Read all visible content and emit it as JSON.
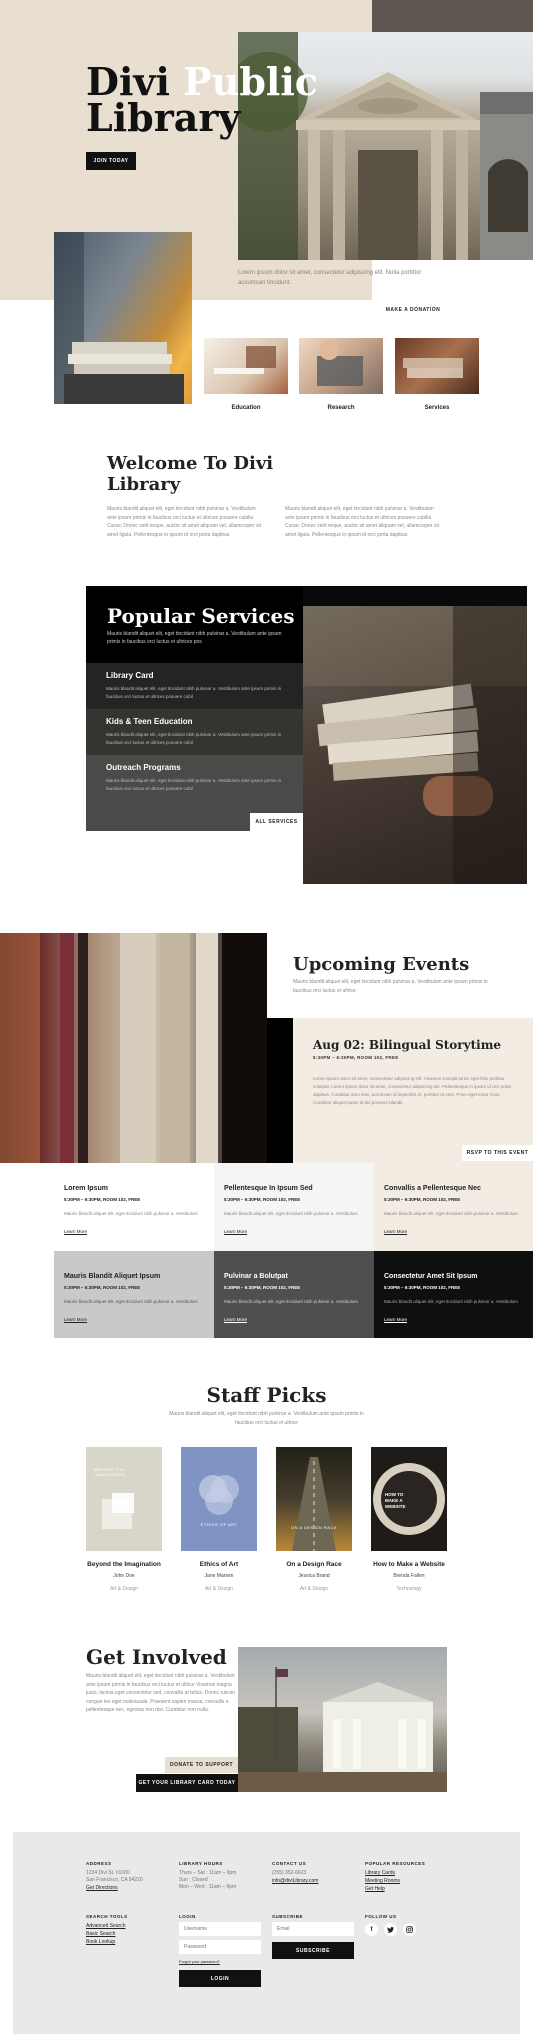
{
  "hero": {
    "title_line1_dark": "Divi",
    "title_line1_light": "Public",
    "title_line2": "Library",
    "join_button": "JOIN TODAY",
    "caption": "Lorem ipsum dolor sit amet, consectetur adipiscing elit. Nulla porttitor accumsan tincidunt.",
    "donation_button": "MAKE A DONATION",
    "tiles": [
      {
        "label": "Education"
      },
      {
        "label": "Research"
      },
      {
        "label": "Services"
      }
    ]
  },
  "welcome": {
    "title_line1": "Welcome To Divi",
    "title_line2": "Library",
    "col1": "Mauris blandit aliquet elit, eget tincidunt nibh pulvinar a. Vestibulum ante ipsum primis in faucibus orci luctus et ultrices posuere cubilia Curae; Donec velit neque, auctor sit amet aliquam vel, ullamcorper sit amet ligula. Pellentesque in ipsum id orci porta dapibus.",
    "col2": "Mauris blandit aliquet elit, eget tincidunt nibh pulvinar a. Vestibulum ante ipsum primis in faucibus orci luctus et ultrices posuere cubilia Curae; Donec velit neque, auctor sit amet aliquam vel, ullamcorper sit amet ligula. Pellentesque in ipsum id orci porta dapibus."
  },
  "services": {
    "title": "Popular Services",
    "intro": "Mauris blandit aliquet elit, eget tincidunt nibh pulvinar a. Vestibulum ante ipsum primis in faucibus orci luctus et ultrices pos",
    "items": [
      {
        "title": "Library Card",
        "text": "Mauris blandit aliquet elit, eget tincidunt nibh pulvinar a. Vestibulum ante ipsum primis in faucibus orci luctus et ultrices posuere cubil"
      },
      {
        "title": "Kids & Teen Education",
        "text": "Mauris blandit aliquet elit, eget tincidunt nibh pulvinar a. Vestibulum ante ipsum primis in faucibus orci luctus et ultrices posuere cubil"
      },
      {
        "title": "Outreach Programs",
        "text": "Mauris blandit aliquet elit, eget tincidunt nibh pulvinar a. Vestibulum ante ipsum primis in faucibus orci luctus et ultrices posuere cubil"
      }
    ],
    "all_button": "ALL SERVICES"
  },
  "events": {
    "title": "Upcoming Events",
    "intro": "Mauris blandit aliquet elit, eget tincidunt nibh pulvinar a. Vestibulum ante ipsum primis in faucibus orci luctus et ultrice",
    "featured": {
      "title": "Aug 02: Bilingual Storytime",
      "meta": "5:30PM – 6:30PM, ROOM 102, FREE",
      "text": "Lorem ipsum dolor sit amet, consectetur adipiscing elit. Vivamus suscipit tortor eget felis porttitor volutpat. Lorem ipsum dolor sit amet, consectetur adipiscing elit. Pellentesque in ipsum id orci porta dapibus. Curabitur arcu erat, accumsan id imperdiet et, porttitor at sem. Proin eget tortor risus. Curabitur aliquet quam id dui posuere blandit.",
      "button": "RSVP TO THIS EVENT"
    },
    "cards": [
      {
        "title": "Lorem Ipsum",
        "meta": "5:30PM – 6:30PM, ROOM 102, FREE",
        "text": "Mauris blandit aliquet elit, eget tincidunt nibh pulvinar a. Vestibulum",
        "link": "Learn More"
      },
      {
        "title": "Pellentesque In Ipsum Sed",
        "meta": "5:30PM – 6:30PM, ROOM 102, FREE",
        "text": "Mauris blandit aliquet elit, eget tincidunt nibh pulvinar a. Vestibulum",
        "link": "Learn More"
      },
      {
        "title": "Convallis a Pellentesque Nec",
        "meta": "5:30PM – 6:30PM, ROOM 102, FREE",
        "text": "Mauris blandit aliquet elit, eget tincidunt nibh pulvinar a. Vestibulum",
        "link": "Learn More"
      },
      {
        "title": "Mauris Blandit Aliquet Ipsum",
        "meta": "5:30PM – 6:30PM, ROOM 102, FREE",
        "text": "Mauris blandit aliquet elit, eget tincidunt nibh pulvinar a. Vestibulum",
        "link": "Learn More"
      },
      {
        "title": "Pulvinar a Bolutpat",
        "meta": "5:30PM – 6:30PM, ROOM 102, FREE",
        "text": "Mauris blandit aliquet elit, eget tincidunt nibh pulvinar a. Vestibulum",
        "link": "Learn More"
      },
      {
        "title": "Consectetur Amet Sit Ipsum",
        "meta": "5:30PM – 6:30PM, ROOM 102, FREE",
        "text": "Mauris blandit aliquet elit, eget tincidunt nibh pulvinar a. Vestibulum",
        "link": "Learn More"
      }
    ]
  },
  "staff": {
    "title": "Staff Picks",
    "intro": "Mauris blandit aliquet elit, eget tincidunt nibh pulvinar a. Vestibulum ante ipsum primis in faucibus orci luctus et ultrice",
    "books": [
      {
        "cover_text": "BEYOND THE IMAGINATION",
        "title": "Beyond the Imagination",
        "author": "John Doe",
        "category": "Art & Design"
      },
      {
        "cover_text": "ETHICS OF ART",
        "title": "Ethics of Art",
        "author": "Jane Marsen",
        "category": "Art & Design"
      },
      {
        "cover_text": "ON A DESIGN RACE",
        "title": "On a Design Race",
        "author": "Jessica Brand",
        "category": "Art & Design"
      },
      {
        "cover_text": "HOW TO MAKE A WEBSITE",
        "title": "How to Make a Website",
        "author": "Brenda Fallen",
        "category": "Technology"
      }
    ]
  },
  "involved": {
    "title": "Get Involved",
    "text": "Mauris blandit aliquet elit, eget tincidunt nibh pulvinar a. Vestibulum ante ipsum primis in faucibus orci luctus et ultrice Vivamus magna justo, lacinia eget consectetur sed, convallis at tellus. Donec rutrum congue leo eget malesuada. Praesent sapien massa, convallis a pellentesque nec, egestas non nisi. Curabitur non nulla.",
    "support_button": "DONATE TO SUPPORT",
    "card_button": "GET YOUR LIBRARY CARD TODAY"
  },
  "footer": {
    "address": {
      "heading": "ADDRESS",
      "lines": [
        "1234 Divi St. #1000",
        "San Francisco, CA 94220"
      ],
      "link": "Get Directions"
    },
    "hours": {
      "heading": "LIBRARY HOURS",
      "lines": [
        "Thurs – Sat : 11am – 9pm",
        "Sun : Closed",
        "Mon – Wed : 11am – 9pm"
      ]
    },
    "contact": {
      "heading": "CONTACT US",
      "lines": [
        "(255) 352-6623"
      ],
      "link": "info@diviLibrary.com"
    },
    "resources": {
      "heading": "POPULAR RESOURCES",
      "links": [
        "Library Cards",
        "Meeting Rooms",
        "Get Help"
      ]
    },
    "tools": {
      "heading": "SEARCH TOOLS",
      "links": [
        "Advanced Search",
        "Basic Search",
        "Book Lookup"
      ]
    },
    "login": {
      "heading": "LOGIN",
      "username_placeholder": "Username",
      "password_placeholder": "Password",
      "forgot": "Forgot your password?",
      "button": "LOGIN"
    },
    "subscribe": {
      "heading": "SUBSCRIBE",
      "email_placeholder": "Email",
      "button": "SUBSCRIBE"
    },
    "follow": {
      "heading": "FOLLOW US",
      "icons": [
        "facebook-icon",
        "twitter-icon",
        "instagram-icon"
      ]
    }
  },
  "colors": {
    "beige": "#e8dfd1",
    "light_beige": "#f2ece3",
    "dark": "#111111",
    "grey_mid": "#4b4a48",
    "footer_bg": "#e9e9e9"
  }
}
